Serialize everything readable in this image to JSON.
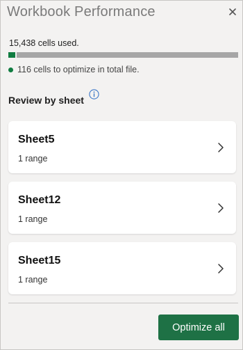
{
  "pane": {
    "title": "Workbook Performance",
    "close_icon": "close-icon"
  },
  "summary": {
    "cells_used": "15,438 cells used.",
    "optimize_fraction": 0.03,
    "optimize_note": "116 cells to optimize in total file.",
    "accent_color": "#107c41"
  },
  "review": {
    "title": "Review by sheet",
    "info_icon": "info-icon",
    "sheets": [
      {
        "name": "Sheet5",
        "detail": "1 range"
      },
      {
        "name": "Sheet12",
        "detail": "1 range"
      },
      {
        "name": "Sheet15",
        "detail": "1 range"
      }
    ]
  },
  "footer": {
    "optimize_all_label": "Optimize all",
    "button_color": "#1e7145"
  }
}
